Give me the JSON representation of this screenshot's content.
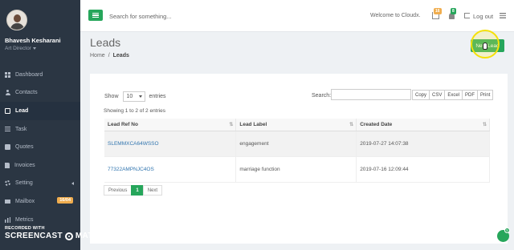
{
  "sidebar": {
    "user_name": "Bhavesh Kesharani",
    "user_role": "Art Director",
    "items": [
      {
        "label": "Dashboard",
        "icon": "dashboard-icon"
      },
      {
        "label": "Contacts",
        "icon": "contacts-icon"
      },
      {
        "label": "Lead",
        "icon": "lead-icon",
        "active": true
      },
      {
        "label": "Task",
        "icon": "task-icon"
      },
      {
        "label": "Quotes",
        "icon": "quotes-icon"
      },
      {
        "label": "Invoices",
        "icon": "invoices-icon"
      },
      {
        "label": "Setting",
        "icon": "settings-icon"
      },
      {
        "label": "Mailbox",
        "icon": "mail-icon",
        "badge": "16/04"
      },
      {
        "label": "Metrics",
        "icon": "metrics-icon"
      }
    ]
  },
  "watermark": {
    "line1": "RECORDED WITH",
    "left": "SCREENCAST",
    "right": "MATIC"
  },
  "topbar": {
    "search_placeholder": "Search for something...",
    "welcome": "Welcome to Cloudx.",
    "inbox_badge": "16",
    "bell_badge": "8",
    "logout": "Log out"
  },
  "page": {
    "title": "Leads",
    "breadcrumb_home": "Home",
    "breadcrumb_sep": "/",
    "breadcrumb_current": "Leads",
    "new_button": "New Lead"
  },
  "table_controls": {
    "show": "Show",
    "length_value": "10",
    "entries": "entries",
    "search_label": "Search:",
    "export_buttons": [
      "Copy",
      "CSV",
      "Excel",
      "PDF",
      "Print"
    ],
    "info": "Showing 1 to 2 of 2 entries"
  },
  "table": {
    "columns": [
      "Lead Ref No",
      "Lead Label",
      "Created Date"
    ],
    "rows": [
      [
        "SLEMMXCA64WSSO",
        "engagement",
        "2019-07-27 14:07:38"
      ],
      [
        "77322AMPNJC4OS",
        "marriage function",
        "2019-07-16 12:09:44"
      ]
    ]
  },
  "pagination": {
    "previous": "Previous",
    "page": "1",
    "next": "Next"
  },
  "chat": {
    "badge": "5"
  },
  "colors": {
    "accent": "#26a65b",
    "sidebar_bg": "#2b3643",
    "link": "#3175af",
    "badge_orange": "#f0ad4e"
  }
}
